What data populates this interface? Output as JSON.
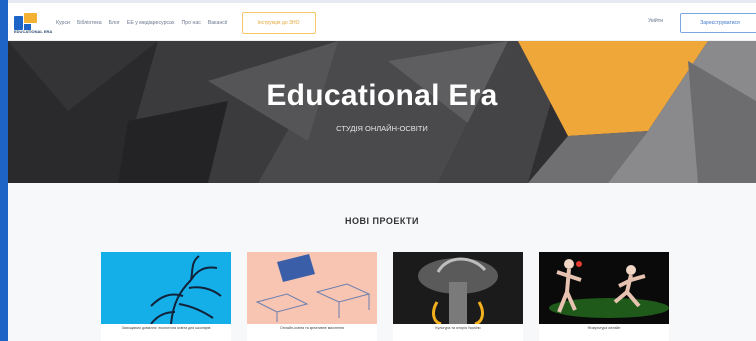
{
  "nav": {
    "logo_text": "EDUCATIONAL ERA",
    "menu": [
      "Курси",
      "Бібліотека",
      "Блог",
      "ЕЕ у медіаресурсах",
      "Про нас",
      "Вакансії"
    ],
    "cta_label": "Інструкція до ЗНО",
    "login_label": "Увійти",
    "register_label": "Зареєструватися"
  },
  "hero": {
    "title": "Educational Era",
    "subtitle": "СТУДІЯ ОНЛАЙН-ОСВІТИ"
  },
  "projects": {
    "title": "НОВІ ПРОЕКТИ",
    "cards": [
      {
        "caption": "Захищаємо довкілля: екологічна освіта для школярів"
      },
      {
        "caption": "Онлайн-освіта та креативне мислення"
      },
      {
        "caption": "Культура та історія України"
      },
      {
        "caption": "Фізкультура онлайн"
      }
    ]
  },
  "colors": {
    "accent_blue": "#1e63c6",
    "accent_orange": "#f0a73a",
    "hero_dark": "#2f2f31"
  }
}
